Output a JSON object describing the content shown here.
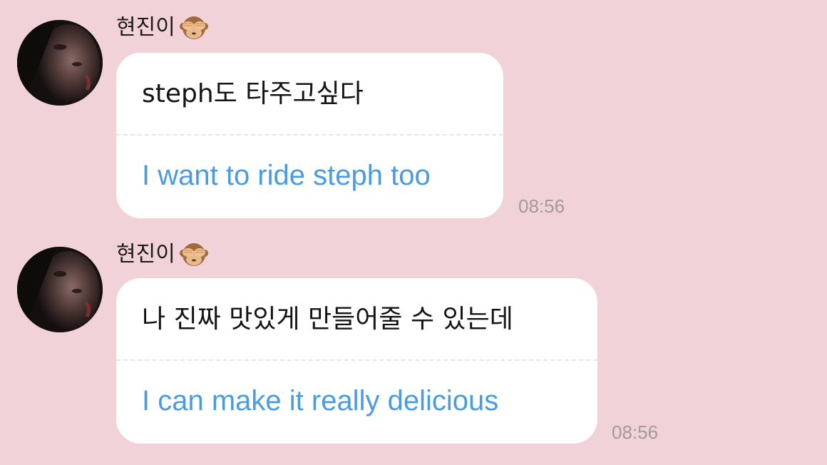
{
  "chat": {
    "messages": [
      {
        "sender": "현진이",
        "sender_emoji": "see-no-evil-monkey-icon",
        "original_text": "steph도 타주고싶다",
        "translated_text": "I want to ride steph too",
        "time": "08:56"
      },
      {
        "sender": "현진이",
        "sender_emoji": "see-no-evil-monkey-icon",
        "original_text": "나 진짜 맛있게 만들어줄 수 있는데",
        "translated_text": "I can make it really delicious",
        "time": "08:56"
      }
    ]
  },
  "colors": {
    "background": "#f1d2d8",
    "bubble": "#ffffff",
    "translation_text": "#4a9be0",
    "timestamp": "#a39a9c"
  }
}
